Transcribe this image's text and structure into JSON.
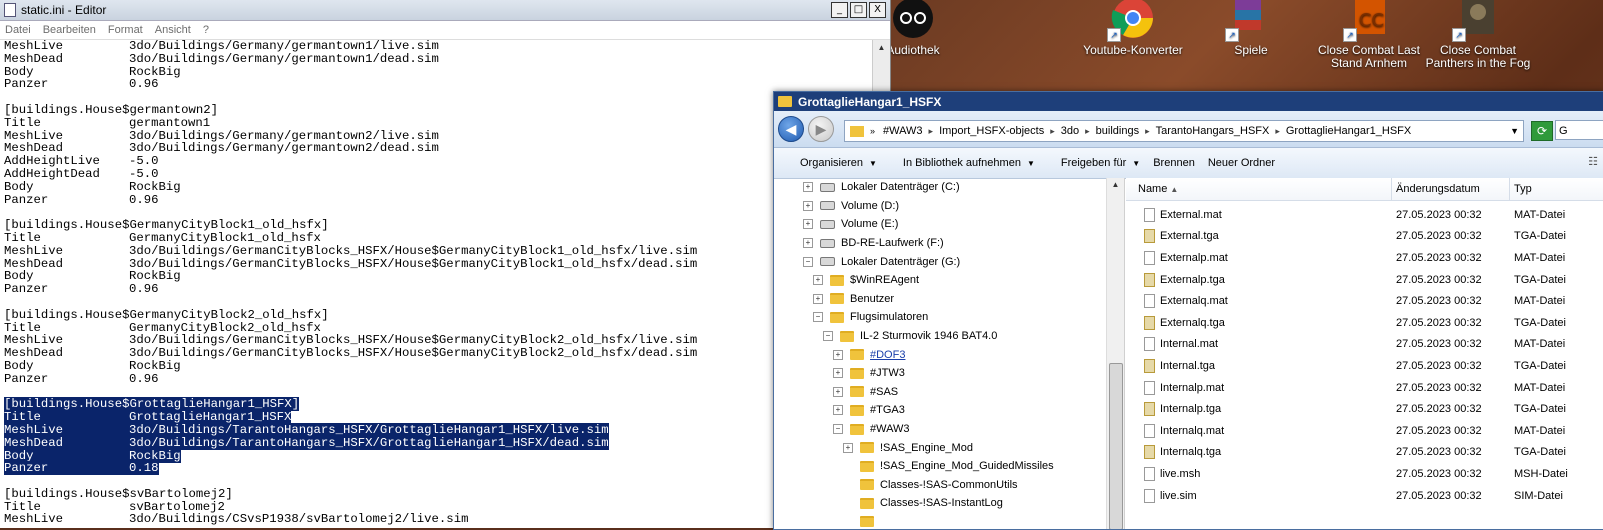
{
  "notepad": {
    "title": "static.ini - Editor",
    "window_buttons": [
      "_",
      "□",
      "X"
    ],
    "menu": [
      "Datei",
      "Bearbeiten",
      "Format",
      "Ansicht",
      "?"
    ],
    "lines": [
      {
        "k": "MeshLive",
        "v": "3do/Buildings/Germany/germantown1/live.sim",
        "sel": false
      },
      {
        "k": "MeshDead",
        "v": "3do/Buildings/Germany/germantown1/dead.sim",
        "sel": false
      },
      {
        "k": "Body",
        "v": "RockBig",
        "sel": false
      },
      {
        "k": "Panzer",
        "v": "0.96",
        "sel": false
      },
      {
        "k": "",
        "v": "",
        "sel": false
      },
      {
        "k": "[buildings.House$germantown2]",
        "v": "",
        "sel": false,
        "full": true
      },
      {
        "k": "Title",
        "v": "germantown1",
        "sel": false
      },
      {
        "k": "MeshLive",
        "v": "3do/Buildings/Germany/germantown2/live.sim",
        "sel": false
      },
      {
        "k": "MeshDead",
        "v": "3do/Buildings/Germany/germantown2/dead.sim",
        "sel": false
      },
      {
        "k": "AddHeightLive",
        "v": "-5.0",
        "sel": false
      },
      {
        "k": "AddHeightDead",
        "v": "-5.0",
        "sel": false
      },
      {
        "k": "Body",
        "v": "RockBig",
        "sel": false
      },
      {
        "k": "Panzer",
        "v": "0.96",
        "sel": false
      },
      {
        "k": "",
        "v": "",
        "sel": false
      },
      {
        "k": "[buildings.House$GermanyCityBlock1_old_hsfx]",
        "v": "",
        "sel": false,
        "full": true
      },
      {
        "k": "Title",
        "v": "GermanyCityBlock1_old_hsfx",
        "sel": false
      },
      {
        "k": "MeshLive",
        "v": "3do/Buildings/GermanCityBlocks_HSFX/House$GermanyCityBlock1_old_hsfx/live.sim",
        "sel": false
      },
      {
        "k": "MeshDead",
        "v": "3do/Buildings/GermanCityBlocks_HSFX/House$GermanyCityBlock1_old_hsfx/dead.sim",
        "sel": false
      },
      {
        "k": "Body",
        "v": "RockBig",
        "sel": false
      },
      {
        "k": "Panzer",
        "v": "0.96",
        "sel": false
      },
      {
        "k": "",
        "v": "",
        "sel": false
      },
      {
        "k": "[buildings.House$GermanyCityBlock2_old_hsfx]",
        "v": "",
        "sel": false,
        "full": true
      },
      {
        "k": "Title",
        "v": "GermanyCityBlock2_old_hsfx",
        "sel": false
      },
      {
        "k": "MeshLive",
        "v": "3do/Buildings/GermanCityBlocks_HSFX/House$GermanyCityBlock2_old_hsfx/live.sim",
        "sel": false
      },
      {
        "k": "MeshDead",
        "v": "3do/Buildings/GermanCityBlocks_HSFX/House$GermanyCityBlock2_old_hsfx/dead.sim",
        "sel": false
      },
      {
        "k": "Body",
        "v": "RockBig",
        "sel": false
      },
      {
        "k": "Panzer",
        "v": "0.96",
        "sel": false
      },
      {
        "k": "",
        "v": "",
        "sel": false
      },
      {
        "k": "[buildings.House$GrottaglieHangar1_HSFX]",
        "v": "",
        "sel": true,
        "full": true
      },
      {
        "k": "Title",
        "v": "GrottaglieHangar1_HSFX",
        "sel": true
      },
      {
        "k": "MeshLive",
        "v": "3do/Buildings/TarantoHangars_HSFX/GrottaglieHangar1_HSFX/live.sim",
        "sel": true
      },
      {
        "k": "MeshDead",
        "v": "3do/Buildings/TarantoHangars_HSFX/GrottaglieHangar1_HSFX/dead.sim",
        "sel": true
      },
      {
        "k": "Body",
        "v": "RockBig",
        "sel": true
      },
      {
        "k": "Panzer",
        "v": "0.18",
        "sel": true
      },
      {
        "k": "",
        "v": "",
        "sel": false
      },
      {
        "k": "[buildings.House$svBartolomej2]",
        "v": "",
        "sel": false,
        "full": true
      },
      {
        "k": "Title",
        "v": "svBartolomej2",
        "sel": false
      },
      {
        "k": "MeshLive",
        "v": "3do/Buildings/CSvsP1938/svBartolomej2/live.sim",
        "sel": false
      }
    ]
  },
  "desktop": {
    "icons": [
      {
        "label": "Audiothek",
        "color": "#111111"
      },
      {
        "label": "Youtube-Konverter",
        "color": "#3a7de0"
      },
      {
        "label": "Spiele",
        "color": "#c0392b"
      },
      {
        "label": "Close Combat Last Stand Arnhem",
        "color": "#d35400"
      },
      {
        "label": "Close Combat  Panthers in the Fog",
        "color": "#6b5b3a"
      }
    ]
  },
  "explorer": {
    "title": "GrottaglieHangar1_HSFX",
    "breadcrumb": [
      "#WAW3",
      "Import_HSFX-objects",
      "3do",
      "buildings",
      "TarantoHangars_HSFX",
      "GrottaglieHangar1_HSFX"
    ],
    "search_placeholder": "G",
    "toolbar": [
      "Organisieren",
      "In Bibliothek aufnehmen",
      "Freigeben für",
      "Brennen",
      "Neuer Ordner"
    ],
    "tree": [
      {
        "label": "Lokaler Datenträger (C:)",
        "indent": 0,
        "exp": "+",
        "type": "drive"
      },
      {
        "label": "Volume (D:)",
        "indent": 0,
        "exp": "+",
        "type": "drive"
      },
      {
        "label": "Volume (E:)",
        "indent": 0,
        "exp": "+",
        "type": "drive"
      },
      {
        "label": "BD-RE-Laufwerk (F:)",
        "indent": 0,
        "exp": "+",
        "type": "drive"
      },
      {
        "label": "Lokaler Datenträger (G:)",
        "indent": 0,
        "exp": "-",
        "type": "drive"
      },
      {
        "label": "$WinREAgent",
        "indent": 1,
        "exp": "+",
        "type": "folder"
      },
      {
        "label": "Benutzer",
        "indent": 1,
        "exp": "+",
        "type": "folder"
      },
      {
        "label": "Flugsimulatoren",
        "indent": 1,
        "exp": "-",
        "type": "folder"
      },
      {
        "label": "IL-2 Sturmovik 1946 BAT4.0",
        "indent": 2,
        "exp": "-",
        "type": "folder"
      },
      {
        "label": "#DOF3",
        "indent": 3,
        "exp": "+",
        "type": "folder",
        "link": true
      },
      {
        "label": "#JTW3",
        "indent": 3,
        "exp": "+",
        "type": "folder"
      },
      {
        "label": "#SAS",
        "indent": 3,
        "exp": "+",
        "type": "folder"
      },
      {
        "label": "#TGA3",
        "indent": 3,
        "exp": "+",
        "type": "folder"
      },
      {
        "label": "#WAW3",
        "indent": 3,
        "exp": "-",
        "type": "folder"
      },
      {
        "label": "!SAS_Engine_Mod",
        "indent": 4,
        "exp": "+",
        "type": "folder"
      },
      {
        "label": "!SAS_Engine_Mod_GuidedMissiles",
        "indent": 4,
        "exp": "",
        "type": "folder"
      },
      {
        "label": "Classes-!SAS-CommonUtils",
        "indent": 4,
        "exp": "",
        "type": "folder"
      },
      {
        "label": "Classes-!SAS-InstantLog",
        "indent": 4,
        "exp": "",
        "type": "folder"
      },
      {
        "label": "",
        "indent": 4,
        "exp": "",
        "type": "folder"
      }
    ],
    "columns": [
      "Name",
      "Änderungsdatum",
      "Typ"
    ],
    "files": [
      {
        "name": "External.mat",
        "date": "27.05.2023 00:32",
        "type": "MAT-Datei",
        "kind": "mat"
      },
      {
        "name": "External.tga",
        "date": "27.05.2023 00:32",
        "type": "TGA-Datei",
        "kind": "tga"
      },
      {
        "name": "Externalp.mat",
        "date": "27.05.2023 00:32",
        "type": "MAT-Datei",
        "kind": "mat"
      },
      {
        "name": "Externalp.tga",
        "date": "27.05.2023 00:32",
        "type": "TGA-Datei",
        "kind": "tga"
      },
      {
        "name": "Externalq.mat",
        "date": "27.05.2023 00:32",
        "type": "MAT-Datei",
        "kind": "mat"
      },
      {
        "name": "Externalq.tga",
        "date": "27.05.2023 00:32",
        "type": "TGA-Datei",
        "kind": "tga"
      },
      {
        "name": "Internal.mat",
        "date": "27.05.2023 00:32",
        "type": "MAT-Datei",
        "kind": "mat"
      },
      {
        "name": "Internal.tga",
        "date": "27.05.2023 00:32",
        "type": "TGA-Datei",
        "kind": "tga"
      },
      {
        "name": "Internalp.mat",
        "date": "27.05.2023 00:32",
        "type": "MAT-Datei",
        "kind": "mat"
      },
      {
        "name": "Internalp.tga",
        "date": "27.05.2023 00:32",
        "type": "TGA-Datei",
        "kind": "tga"
      },
      {
        "name": "Internalq.mat",
        "date": "27.05.2023 00:32",
        "type": "MAT-Datei",
        "kind": "mat"
      },
      {
        "name": "Internalq.tga",
        "date": "27.05.2023 00:32",
        "type": "TGA-Datei",
        "kind": "tga"
      },
      {
        "name": "live.msh",
        "date": "27.05.2023 00:32",
        "type": "MSH-Datei",
        "kind": "mat"
      },
      {
        "name": "live.sim",
        "date": "27.05.2023 00:32",
        "type": "SIM-Datei",
        "kind": "mat"
      }
    ]
  }
}
